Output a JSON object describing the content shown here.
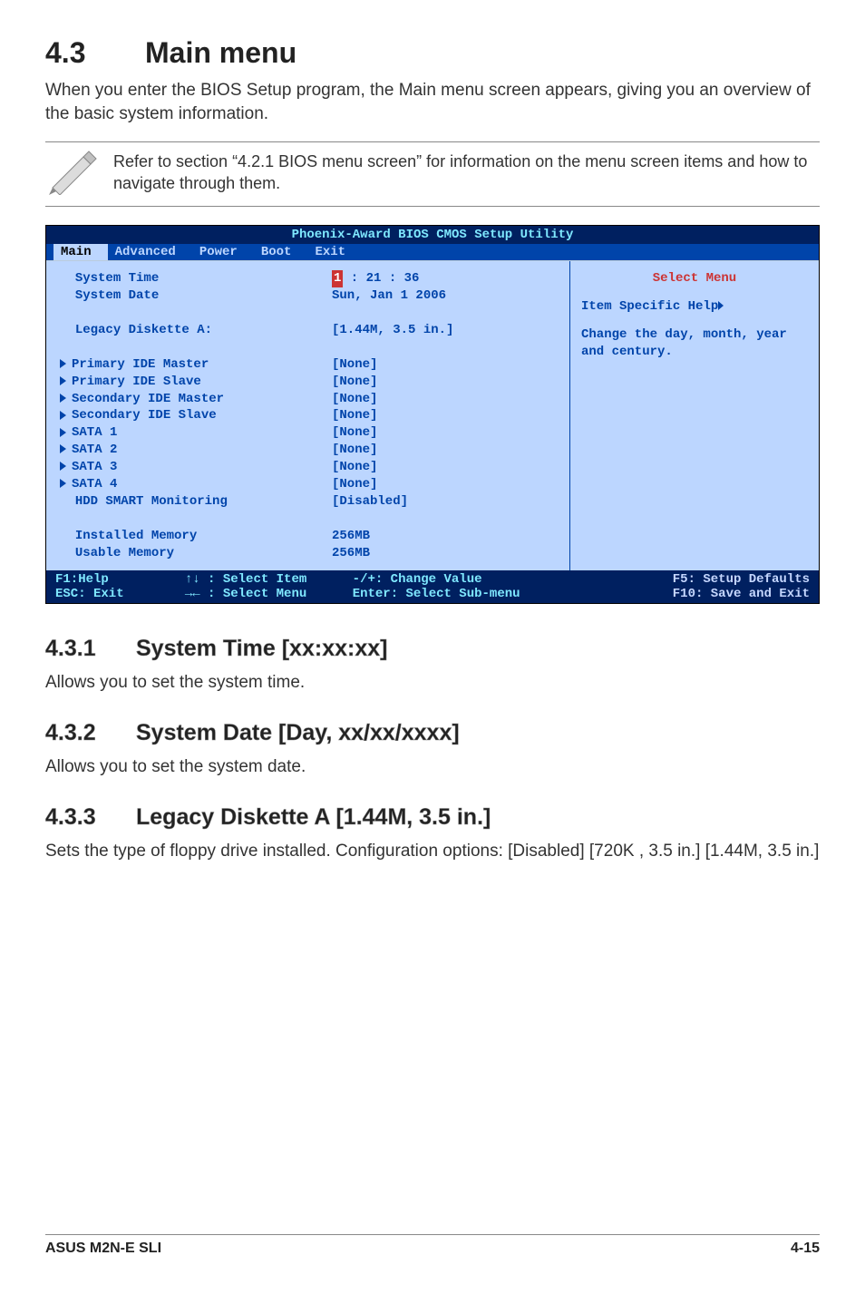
{
  "h1": {
    "num": "4.3",
    "title": "Main menu"
  },
  "intro": "When you enter the BIOS Setup program, the Main menu screen appears, giving you an overview of the basic system information.",
  "note": "Refer to section “4.2.1  BIOS menu screen” for information on the menu screen items and how to navigate through them.",
  "bios": {
    "title": "Phoenix-Award BIOS CMOS Setup Utility",
    "menu": [
      "Main",
      "Advanced",
      "Power",
      "Boot",
      "Exit"
    ],
    "rows": [
      {
        "arrow": "",
        "label": "System Time",
        "value_prefix": "",
        "cursor": "1",
        "value_suffix": " : 21 : 36"
      },
      {
        "arrow": "",
        "label": "System Date",
        "value": "Sun, Jan 1 2006"
      },
      {
        "spacer": true
      },
      {
        "arrow": "",
        "label": "Legacy Diskette A:",
        "value": "[1.44M, 3.5 in.]"
      },
      {
        "spacer": true
      },
      {
        "arrow": "▶",
        "label": "Primary IDE Master",
        "value": "[None]"
      },
      {
        "arrow": "▶",
        "label": "Primary IDE Slave",
        "value": "[None]"
      },
      {
        "arrow": "▶",
        "label": "Secondary IDE Master",
        "value": "[None]"
      },
      {
        "arrow": "▶",
        "label": "Secondary IDE Slave",
        "value": "[None]"
      },
      {
        "arrow": "▶",
        "label": "SATA 1",
        "value": "[None]"
      },
      {
        "arrow": "▶",
        "label": "SATA 2",
        "value": "[None]"
      },
      {
        "arrow": "▶",
        "label": "SATA 3",
        "value": "[None]"
      },
      {
        "arrow": "▶",
        "label": "SATA 4",
        "value": "[None]"
      },
      {
        "arrow": "",
        "label": "HDD SMART Monitoring",
        "value": "[Disabled]"
      },
      {
        "spacer": true
      },
      {
        "arrow": "",
        "label": "Installed Memory",
        "value": "256MB"
      },
      {
        "arrow": "",
        "label": "Usable Memory",
        "value": "256MB"
      }
    ],
    "right": {
      "title": "Select Menu",
      "help_label": "Item Specific Help",
      "help_text": "Change the day, month, year and century."
    },
    "footer": {
      "c1a": "F1:Help",
      "c1b": "ESC: Exit",
      "c2a": "↑↓ : Select Item",
      "c2b": "→← : Select Menu",
      "c3a": "-/+: Change Value",
      "c3b": "Enter: Select Sub-menu",
      "c4a": "F5: Setup Defaults",
      "c4b": "F10: Save and Exit"
    }
  },
  "sec1": {
    "num": "4.3.1",
    "title": "System Time [xx:xx:xx]",
    "text": "Allows you to set the system time."
  },
  "sec2": {
    "num": "4.3.2",
    "title": "System Date [Day, xx/xx/xxxx]",
    "text": "Allows you to set the system date."
  },
  "sec3": {
    "num": "4.3.3",
    "title": "Legacy Diskette A [1.44M, 3.5 in.]",
    "text": "Sets the type of floppy drive installed. Configuration options: [Disabled] [720K , 3.5 in.] [1.44M, 3.5 in.]"
  },
  "footer": {
    "left": "ASUS M2N-E SLI",
    "right": "4-15"
  }
}
